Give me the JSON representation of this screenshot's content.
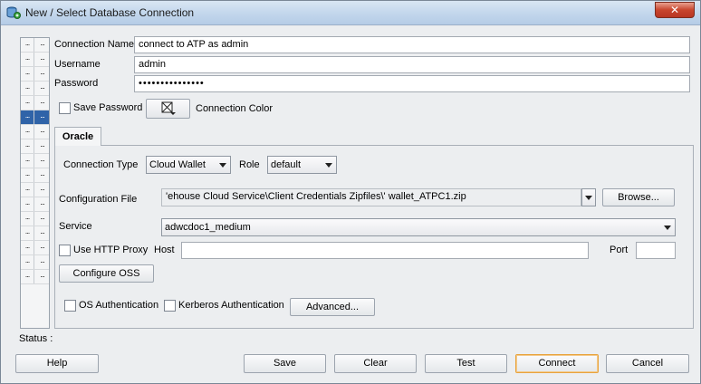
{
  "window": {
    "title": "New / Select Database Connection",
    "close_symbol": "✕"
  },
  "grid": {
    "cell": "...",
    "rows": 17,
    "selected_row": 5
  },
  "form": {
    "connection_name_label": "Connection Name",
    "connection_name_value": "connect to ATP as admin",
    "username_label": "Username",
    "username_value": "admin",
    "password_label": "Password",
    "password_value": "•••••••••••••••",
    "save_password_label": "Save Password",
    "connection_color_label": "Connection Color"
  },
  "tabs": [
    {
      "label": "Oracle"
    }
  ],
  "oracle": {
    "connection_type_label": "Connection Type",
    "connection_type_value": "Cloud Wallet",
    "role_label": "Role",
    "role_value": "default",
    "config_file_label": "Configuration File",
    "config_file_value": "'ehouse Cloud Service\\Client Credentials Zipfiles\\' wallet_ATPC1.zip",
    "browse_label": "Browse...",
    "service_label": "Service",
    "service_value": "adwcdoc1_medium",
    "use_http_proxy_label": "Use HTTP Proxy",
    "host_label": "Host",
    "port_label": "Port",
    "configure_oss_label": "Configure OSS",
    "os_auth_label": "OS Authentication",
    "kerberos_auth_label": "Kerberos Authentication",
    "advanced_label": "Advanced..."
  },
  "status_label": "Status :",
  "buttons": {
    "help": "Help",
    "save": "Save",
    "clear": "Clear",
    "test": "Test",
    "connect": "Connect",
    "cancel": "Cancel"
  },
  "colors": {
    "selection": "#2f63a8",
    "title_gradient": "#c2d6ec",
    "connect_border": "#e8a33c"
  },
  "icons": [
    "database-connection-icon",
    "close-icon",
    "color-picker-icon",
    "dropdown-arrow-icon"
  ]
}
